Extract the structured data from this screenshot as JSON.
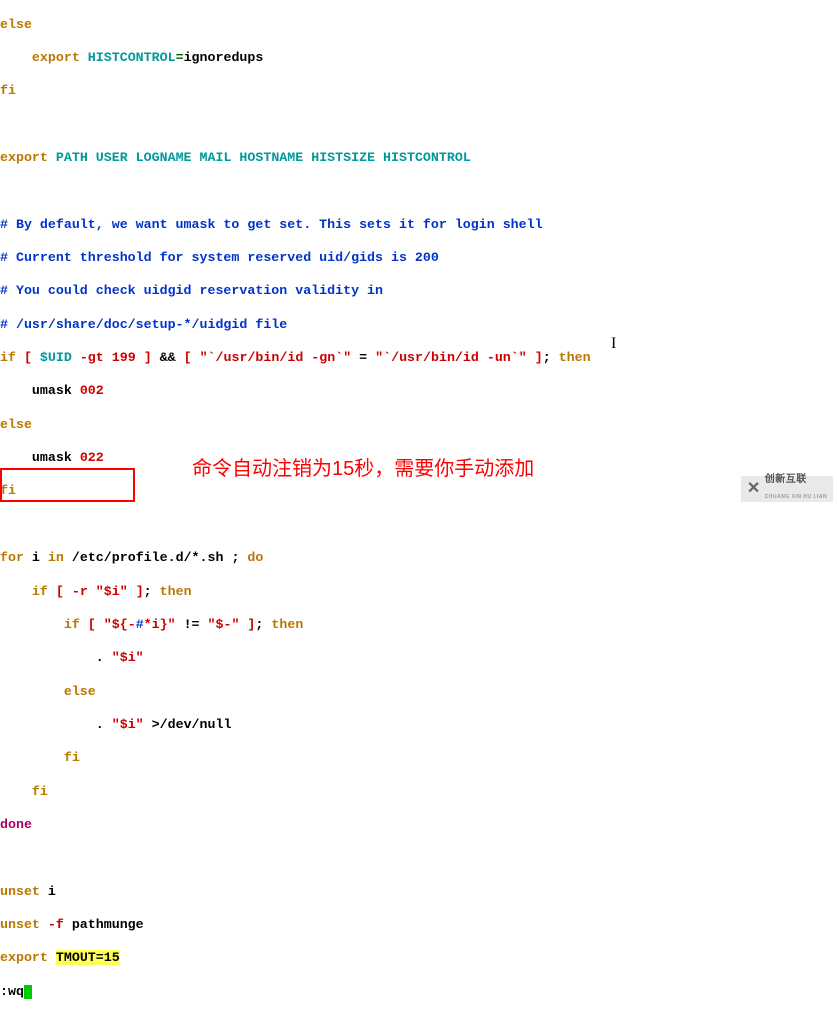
{
  "code": {
    "l01_else": "else",
    "l02_indent": "    ",
    "l02_export": "export",
    "l02_sp": " ",
    "l02_var": "HISTCONTROL",
    "l02_eq": "=",
    "l02_val": "ignoredups",
    "l03_fi": "fi",
    "l05_export": "export",
    "l05_sp": " ",
    "l05_vars": "PATH USER LOGNAME MAIL HOSTNAME HISTSIZE HISTCONTROL",
    "l07_c": "# By default, we want umask to get set. This sets it for login shell",
    "l08_c": "# Current threshold for system reserved uid/gids is 200",
    "l09_c": "# You could check uidgid reservation validity in",
    "l10_c": "# /usr/share/doc/setup-*/uidgid file",
    "l11_if": "if",
    "l11_sp1": " ",
    "l11_lb": "[",
    "l11_sp2": " ",
    "l11_uid": "$UID",
    "l11_gt": " -gt ",
    "l11_199": "199",
    "l11_sp3": " ",
    "l11_rb": "]",
    "l11_and": " && ",
    "l11_lb2": "[",
    "l11_sp4": " ",
    "l11_q1": "\"`/usr/bin/id -gn`\"",
    "l11_eq": " = ",
    "l11_q2": "\"`/usr/bin/id -un`\"",
    "l11_sp5": " ",
    "l11_rb2": "]",
    "l11_semi": "; ",
    "l11_then": "then",
    "l12_indent": "    ",
    "l12_umask": "umask ",
    "l12_val": "002",
    "l13_else": "else",
    "l14_indent": "    ",
    "l14_umask": "umask ",
    "l14_val": "022",
    "l15_fi": "fi",
    "l17_for": "for",
    "l17_i": " i ",
    "l17_in": "in",
    "l17_path": " /etc/profile.d/*.sh ; ",
    "l17_do": "do",
    "l18_indent": "    ",
    "l18_if": "if",
    "l18_sp": " ",
    "l18_lb": "[",
    "l18_r": " -r ",
    "l18_qi": "\"$i\"",
    "l18_sp2": " ",
    "l18_rb": "]",
    "l18_semi": "; ",
    "l18_then": "then",
    "l19_indent": "        ",
    "l19_if": "if",
    "l19_sp": " ",
    "l19_lb": "[",
    "l19_sp2": " ",
    "l19_q1a": "\"${-",
    "l19_hash": "#",
    "l19_q1b": "*i}\"",
    "l19_ne": " != ",
    "l19_q2": "\"$-\"",
    "l19_sp3": " ",
    "l19_rb": "]",
    "l19_semi": "; ",
    "l19_then": "then",
    "l20_indent": "            ",
    "l20_dot": ". ",
    "l20_qi": "\"$i\"",
    "l21_indent": "        ",
    "l21_else": "else",
    "l22_indent": "            ",
    "l22_dot": ". ",
    "l22_qi": "\"$i\"",
    "l22_gt": " >",
    "l22_devnull": "/dev/null",
    "l23_indent": "        ",
    "l23_fi": "fi",
    "l24_indent": "    ",
    "l24_fi": "fi",
    "l25_done": "done",
    "l27_unset": "unset",
    "l27_i": " i",
    "l28_unset": "unset",
    "l28_f": " -f ",
    "l28_pm": "pathmunge",
    "l29_export": "export",
    "l29_sp": " ",
    "l29_tmout": "TMOUT",
    "l29_eq": "=",
    "l29_15": "15",
    "l30_wq": ":wq"
  },
  "annotation": "命令自动注销为15秒，需要你手动添加",
  "watermark": "创新互联",
  "watermark_sub": "CHUANG XIN HU LIAN"
}
